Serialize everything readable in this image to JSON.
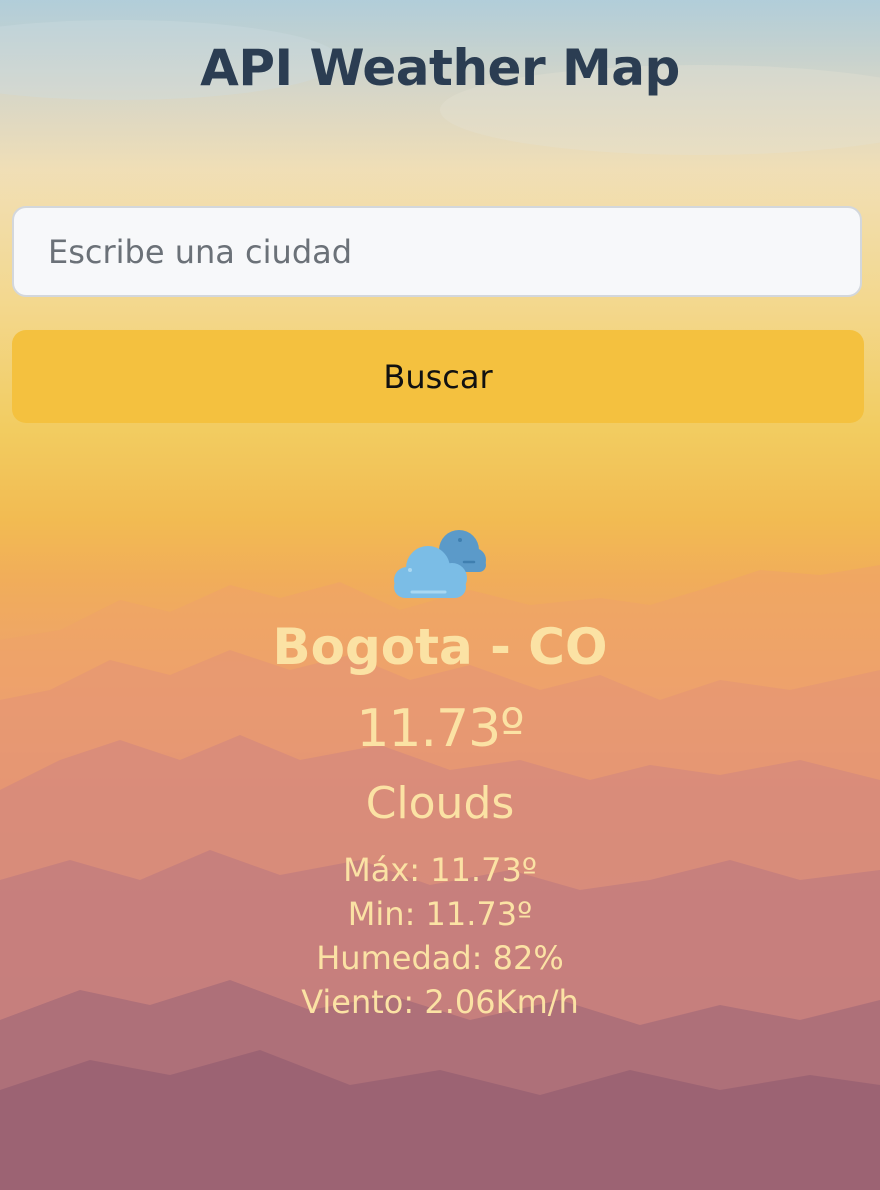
{
  "header": {
    "title": "API Weather Map"
  },
  "search": {
    "placeholder": "Escribe una ciudad",
    "value": "",
    "button_label": "Buscar"
  },
  "weather": {
    "icon": "clouds-icon",
    "location": "Bogota - CO",
    "temperature": "11.73º",
    "description": "Clouds",
    "max": "Máx: 11.73º",
    "min": "Min: 11.73º",
    "humidity": "Humedad: 82%",
    "wind": "Viento: 2.06Km/h"
  },
  "colors": {
    "title": "#2b3d52",
    "button": "#f4c13f",
    "weather_text": "#fbe2a4",
    "input_bg": "#f7f8fa"
  }
}
